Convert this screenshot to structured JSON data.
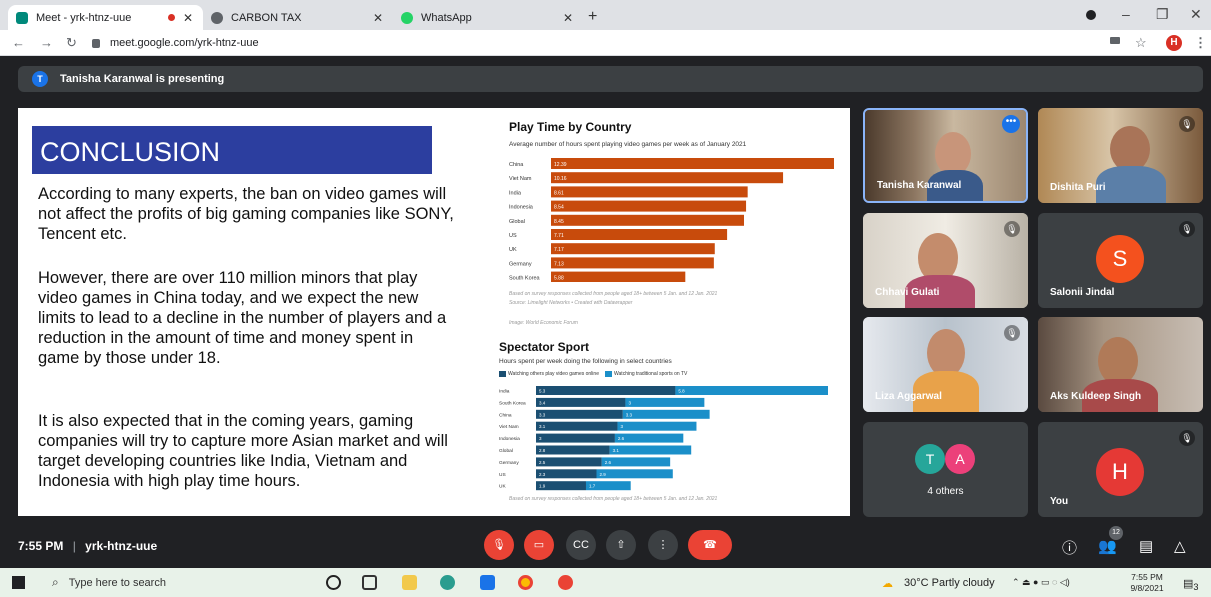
{
  "browser": {
    "tabs": [
      {
        "title": "Meet - yrk-htnz-uue",
        "active": true
      },
      {
        "title": "CARBON TAX",
        "active": false
      },
      {
        "title": "WhatsApp",
        "active": false
      }
    ],
    "new_tab": "+",
    "url": "meet.google.com/yrk-htnz-uue",
    "profile_initial": "H"
  },
  "meet": {
    "presenting_initial": "T",
    "presenting_text": "Tanisha Karanwal is presenting",
    "time": "7:55 PM",
    "separator": "|",
    "meeting_code": "yrk-htnz-uue",
    "people_count": "12"
  },
  "slide": {
    "heading": "CONCLUSION",
    "paragraphs": [
      "According to many experts, the ban on video games will not affect the profits of big gaming companies like SONY, Tencent etc.",
      "However, there are over 110 million minors that play video games in China today, and we expect the new limits to lead to a decline in the number of players and a reduction in the amount of time and money spent in game by those under 18.",
      "It is also expected that in the coming years, gaming companies will try to capture more Asian market and will target developing countries like India, Vietnam and Indonesia with high play time hours."
    ]
  },
  "chart_data": [
    {
      "type": "bar",
      "orientation": "horizontal",
      "title": "Play Time by Country",
      "subtitle": "Average number of hours spent playing video games per week as of January 2021",
      "categories": [
        "China",
        "Viet Nam",
        "India",
        "Indonesia",
        "Global",
        "US",
        "UK",
        "Germany",
        "South Korea"
      ],
      "values": [
        12.39,
        10.16,
        8.61,
        8.54,
        8.45,
        7.71,
        7.17,
        7.13,
        5.88
      ],
      "value_labels": [
        "12.39",
        "10.16",
        "8.61",
        "8.54",
        "8.45",
        "7.71",
        "7.17",
        "7.13",
        "5.88"
      ],
      "color": "#c84b0c",
      "note": "Based on survey responses collected from people aged 18+ between 5 Jan. and 12 Jan. 2021",
      "source": "Source: Limelight Networks • Created with Datawrapper",
      "image_credit": "Image: World Economic Forum"
    },
    {
      "type": "bar",
      "orientation": "horizontal",
      "stacked": true,
      "title": "Spectator Sport",
      "subtitle": "Hours spent per week doing the following in select countries",
      "categories": [
        "India",
        "South Korea",
        "China",
        "Viet Nam",
        "Indonesia",
        "Global",
        "Germany",
        "US",
        "UK"
      ],
      "series": [
        {
          "name": "Watching others play video games online",
          "color": "#1b4f72",
          "values": [
            5.3,
            3.4,
            3.3,
            3.1,
            3.0,
            2.8,
            2.5,
            2.3,
            1.9
          ],
          "labels": [
            "5.3",
            "3.4",
            "3.3",
            "3.1",
            "3",
            "2.8",
            "2.5",
            "2.3",
            "1.9"
          ]
        },
        {
          "name": "Watching traditional sports on TV",
          "color": "#1b8fc9",
          "values": [
            5.8,
            3.0,
            3.3,
            3.0,
            2.6,
            3.1,
            2.6,
            2.9,
            1.7
          ],
          "labels": [
            "5.8",
            "3",
            "3.3",
            "3",
            "2.6",
            "3.1",
            "2.6",
            "2.9",
            "1.7"
          ]
        }
      ],
      "note": "Based on survey responses collected from people aged 18+ between 5 Jan. and 12 Jan. 2021"
    }
  ],
  "participants": [
    {
      "name": "Tanisha Karanwal"
    },
    {
      "name": "Dishita Puri"
    },
    {
      "name": "Chhavi Gulati"
    },
    {
      "name": "Salonii Jindal",
      "initial": "S"
    },
    {
      "name": "Liza Aggarwal"
    },
    {
      "name": "Aks Kuldeep Singh"
    },
    {
      "others_label": "4 others",
      "initials": [
        "T",
        "A"
      ]
    },
    {
      "name": "You",
      "initial": "H"
    }
  ],
  "taskbar": {
    "search_placeholder": "Type here to search",
    "weather": "30°C  Partly cloudy",
    "time": "7:55 PM",
    "date": "9/8/2021",
    "notification_count": "3"
  }
}
